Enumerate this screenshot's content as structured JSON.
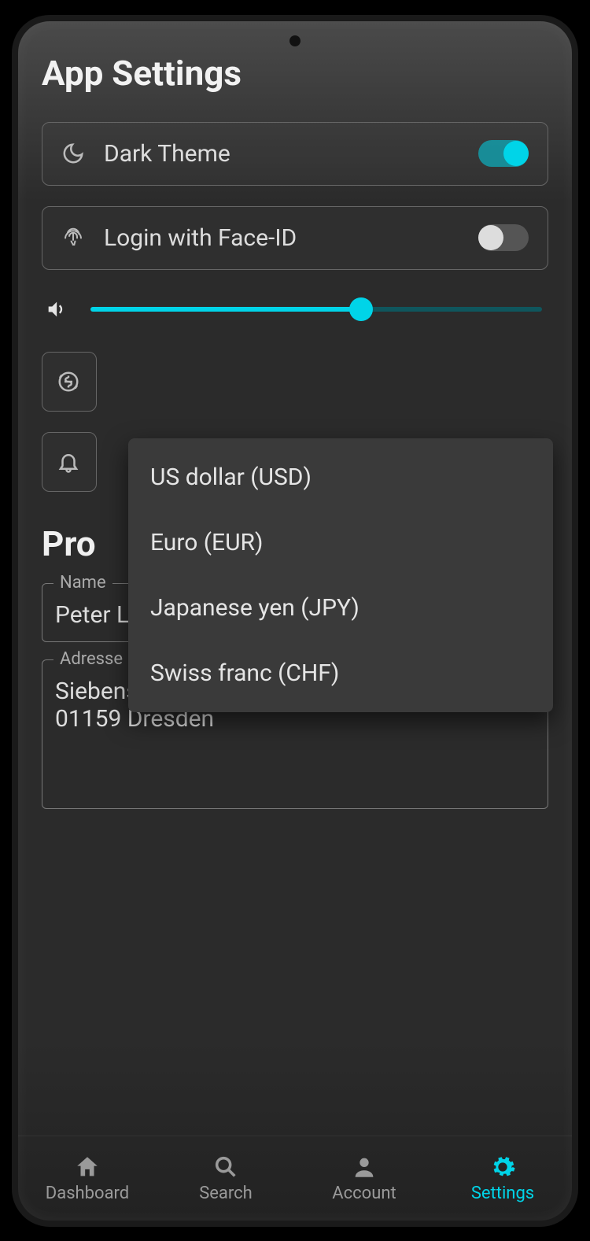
{
  "header": {
    "title": "App Settings"
  },
  "settings": {
    "dark_theme": {
      "label": "Dark Theme",
      "on": true
    },
    "face_id": {
      "label": "Login with Face-ID",
      "on": false
    },
    "volume": {
      "percent": 60
    },
    "currency": {
      "icon": "currency-exchange-icon"
    },
    "notifications": {
      "icon": "bell-icon"
    }
  },
  "dropdown": {
    "options": [
      "US dollar (USD)",
      "Euro (EUR)",
      "Japanese yen (JPY)",
      "Swiss franc (CHF)"
    ]
  },
  "profile": {
    "title_prefix": "Pro",
    "name_label": "Name",
    "name_value": "Peter Larsen",
    "address_label": "Adresse",
    "address_value": "Siebenstraße 24\n01159 Dresden"
  },
  "nav": {
    "items": [
      {
        "label": "Dashboard",
        "active": false
      },
      {
        "label": "Search",
        "active": false
      },
      {
        "label": "Account",
        "active": false
      },
      {
        "label": "Settings",
        "active": true
      }
    ]
  },
  "colors": {
    "accent": "#00d4e8"
  }
}
